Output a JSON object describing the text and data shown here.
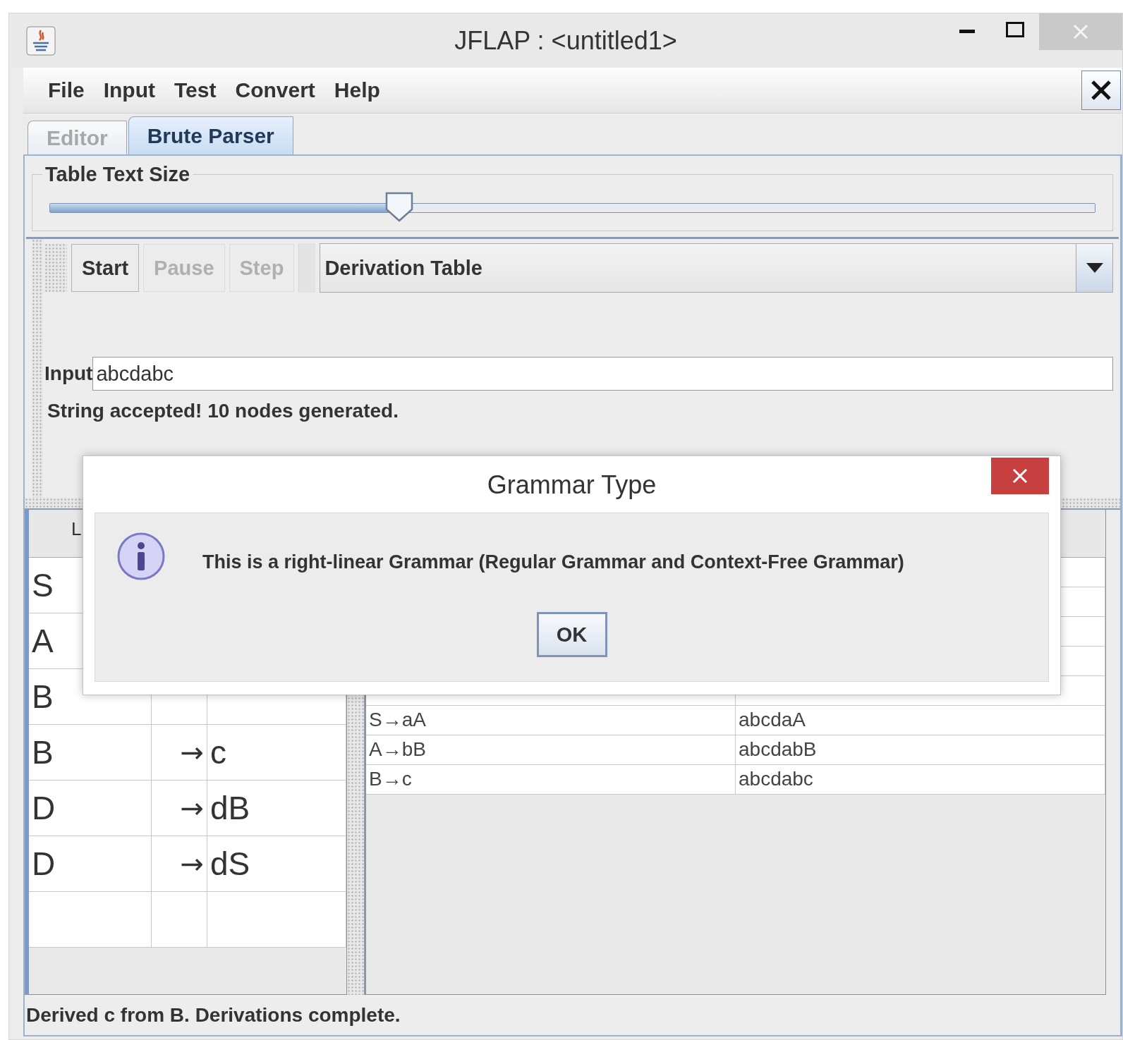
{
  "window": {
    "title": "JFLAP : <untitled1>"
  },
  "menu": [
    "File",
    "Input",
    "Test",
    "Convert",
    "Help"
  ],
  "tabs": [
    {
      "label": "Editor",
      "selected": false
    },
    {
      "label": "Brute Parser",
      "selected": true
    }
  ],
  "text_size": {
    "label": "Table Text Size",
    "level": 0.334
  },
  "toolbar": {
    "buttons": [
      {
        "label": "Start",
        "disabled": false
      },
      {
        "label": "Pause",
        "disabled": true
      },
      {
        "label": "Step",
        "disabled": true
      }
    ],
    "view": "Derivation Table"
  },
  "input": {
    "label": "Input",
    "value": "abcdabc"
  },
  "result": "String accepted!  10 nodes generated.",
  "grammar_table": {
    "columns": [
      "L"
    ],
    "rows": [
      {
        "lhs": "S"
      },
      {
        "lhs": "A"
      },
      {
        "lhs": "B"
      },
      {
        "lhs": "B",
        "arrow": "→",
        "rhs": "c"
      },
      {
        "lhs": "D",
        "arrow": "→",
        "rhs": "dB"
      },
      {
        "lhs": "D",
        "arrow": "→",
        "rhs": "dS"
      }
    ]
  },
  "derivation_table": {
    "rows": [
      {
        "production": "S→aA",
        "derivation": "abcdaA"
      },
      {
        "production": "A→bB",
        "derivation": "abcdabB"
      },
      {
        "production": "B→c",
        "derivation": "abcdabc"
      }
    ]
  },
  "status_bar": "Derived c from B.  Derivations complete.",
  "dialog": {
    "title": "Grammar Type",
    "message": "This is a right-linear Grammar (Regular Grammar and Context-Free Grammar)",
    "buttons": [
      "OK"
    ]
  }
}
